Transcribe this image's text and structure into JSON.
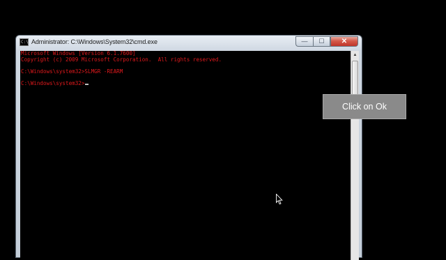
{
  "window": {
    "title": "Administrator: C:\\Windows\\System32\\cmd.exe",
    "title_icon_text": "C:\\",
    "buttons": {
      "minimize": "—",
      "maximize": "☐",
      "close": "✕"
    }
  },
  "console": {
    "lines": [
      "Microsoft Windows [Version 6.1.7600]",
      "Copyright (c) 2009 Microsoft Corporation.  All rights reserved.",
      "",
      "C:\\Windows\\system32>SLMGR -REARM",
      "",
      "C:\\Windows\\system32>"
    ],
    "text_color": "#e0191c"
  },
  "tooltip": {
    "text": "Click on Ok"
  },
  "scrollbar": {
    "up_glyph": "▲"
  }
}
